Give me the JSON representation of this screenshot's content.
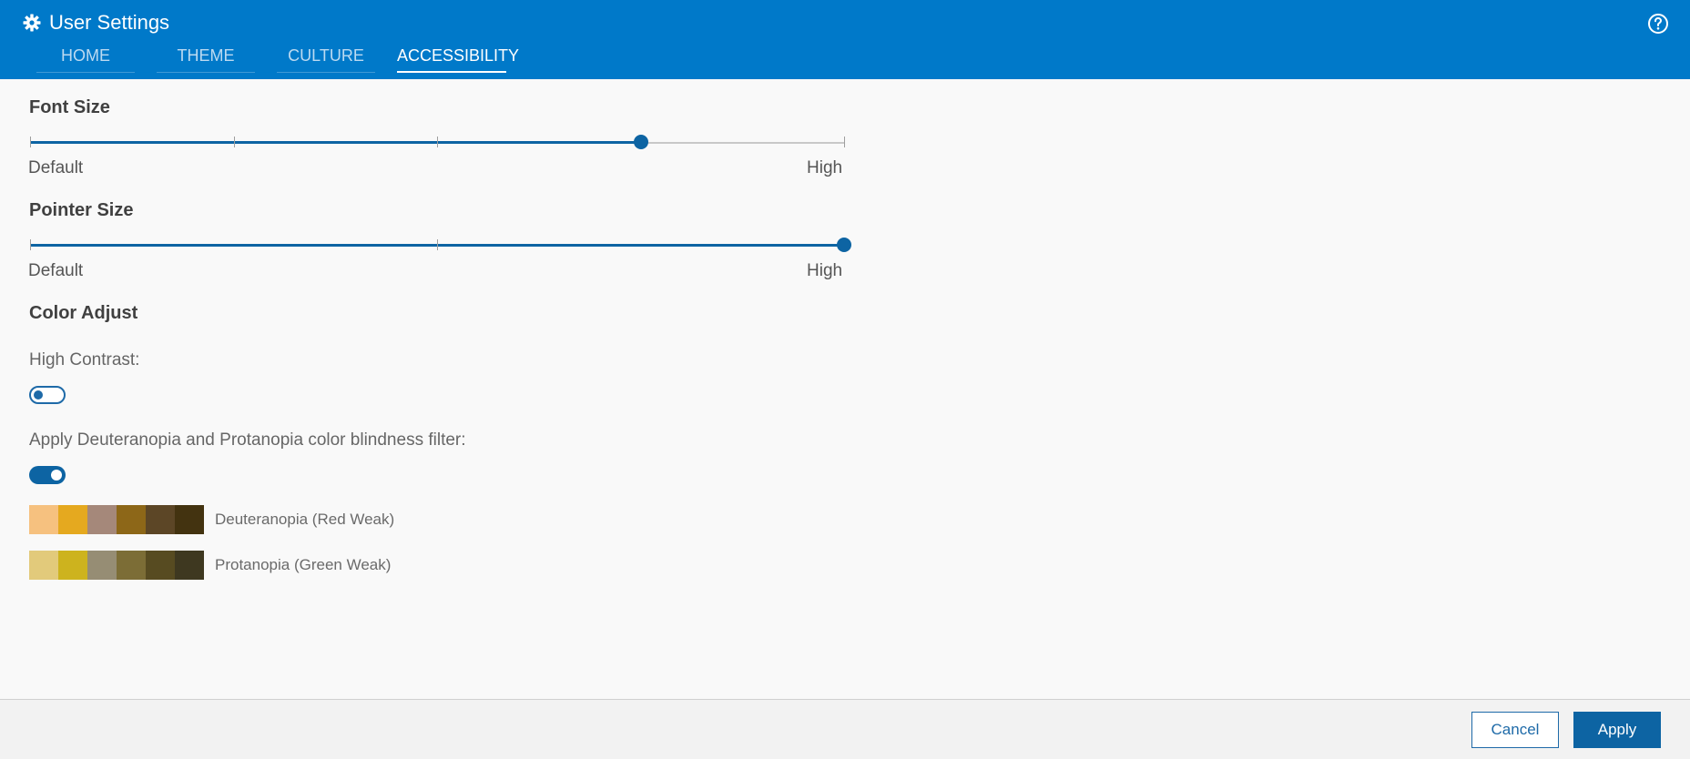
{
  "header": {
    "title": "User Settings",
    "icon": "gear-icon",
    "help_icon": "help-icon",
    "tabs": [
      {
        "label": "HOME"
      },
      {
        "label": "THEME"
      },
      {
        "label": "CULTURE"
      },
      {
        "label": "ACCESSIBILITY",
        "active": true
      }
    ]
  },
  "font_size": {
    "label": "Font Size",
    "min_label": "Default",
    "max_label": "High",
    "steps": 5,
    "value_step": 4
  },
  "pointer_size": {
    "label": "Pointer Size",
    "min_label": "Default",
    "max_label": "High",
    "steps": 3,
    "value_step": 3
  },
  "color_adjust": {
    "label": "Color Adjust",
    "high_contrast": {
      "label": "High Contrast:",
      "enabled": false
    },
    "color_blind_filter": {
      "label": "Apply Deuteranopia and Protanopia color blindness filter:",
      "enabled": true
    },
    "palettes": [
      {
        "label": "Deuteranopia (Red Weak)",
        "colors": [
          "#f6c17f",
          "#e5a91f",
          "#a5887a",
          "#8d6718",
          "#5c4626",
          "#433310"
        ]
      },
      {
        "label": "Protanopia (Green Weak)",
        "colors": [
          "#e2ca7b",
          "#cdb31e",
          "#968d74",
          "#7c6d36",
          "#574b21",
          "#3e3820"
        ]
      }
    ]
  },
  "footer": {
    "cancel_label": "Cancel",
    "apply_label": "Apply"
  },
  "colors": {
    "header_bg": "#0079c9",
    "accent": "#0d64a3",
    "track": "#c8c8c8"
  }
}
